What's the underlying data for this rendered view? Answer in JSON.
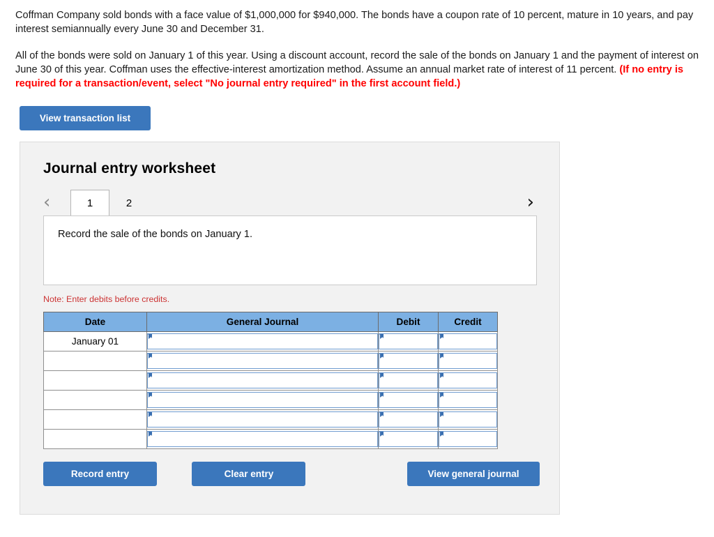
{
  "problem": {
    "paragraph_1": "Coffman Company sold bonds with a face value of $1,000,000 for $940,000. The bonds have a coupon rate of 10 percent, mature in 10 years, and pay interest semiannually every June 30 and December 31.",
    "paragraph_2_plain": "All of the bonds were sold on January 1 of this year. Using a discount account, record the sale of the bonds on January 1 and the payment of interest on June 30 of this year. Coffman uses the effective-interest amortization method. Assume an annual market rate of interest of 11 percent. ",
    "paragraph_2_red": "(If no entry is required for a transaction/event, select \"No journal entry required\" in the first account field.)"
  },
  "toolbar": {
    "view_transaction_list_label": "View transaction list"
  },
  "worksheet": {
    "title": "Journal entry worksheet",
    "nav": {
      "prev_icon": "‹",
      "next_icon": "›"
    },
    "tabs": [
      {
        "label": "1",
        "active": true
      },
      {
        "label": "2",
        "active": false
      }
    ],
    "instruction": "Record the sale of the bonds on January 1.",
    "note": "Note: Enter debits before credits.",
    "table": {
      "headers": [
        "Date",
        "General Journal",
        "Debit",
        "Credit"
      ],
      "rows": [
        {
          "date": "January 01",
          "general_journal": "",
          "debit": "",
          "credit": ""
        },
        {
          "date": "",
          "general_journal": "",
          "debit": "",
          "credit": ""
        },
        {
          "date": "",
          "general_journal": "",
          "debit": "",
          "credit": ""
        },
        {
          "date": "",
          "general_journal": "",
          "debit": "",
          "credit": ""
        },
        {
          "date": "",
          "general_journal": "",
          "debit": "",
          "credit": ""
        },
        {
          "date": "",
          "general_journal": "",
          "debit": "",
          "credit": ""
        }
      ]
    },
    "actions": {
      "record_entry_label": "Record entry",
      "clear_entry_label": "Clear entry",
      "view_general_journal_label": "View general journal"
    }
  },
  "colors": {
    "button_blue": "#3b77bc",
    "table_header_blue": "#7cb0e3",
    "panel_gray": "#f2f2f2",
    "alert_red": "#ff0000",
    "note_red": "#cc3333",
    "field_border_blue": "#6e9bd0"
  }
}
